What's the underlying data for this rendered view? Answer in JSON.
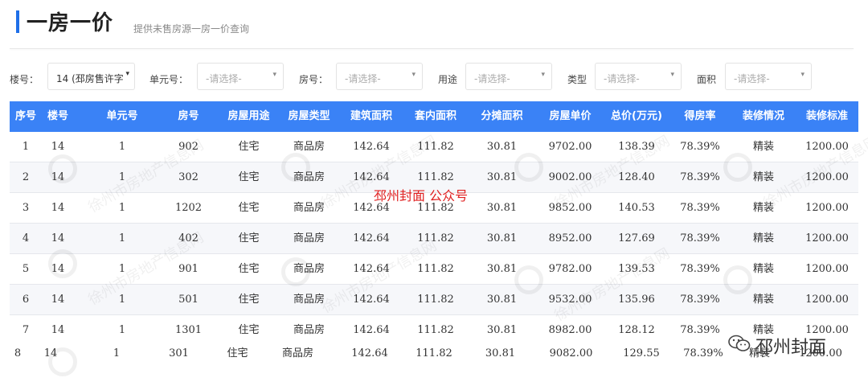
{
  "header": {
    "title": "一房一价",
    "subtitle": "提供未售房源一房一价查询"
  },
  "filters": {
    "building_label": "楼号：",
    "building_value": "14 (邳房售许字",
    "unit_label": "单元号：",
    "unit_placeholder": "-请选择-",
    "room_label": "房号：",
    "room_placeholder": "-请选择-",
    "usage_label": "用途",
    "usage_placeholder": "-请选择-",
    "type_label": "类型",
    "type_placeholder": "-请选择-",
    "area_label": "面积",
    "area_placeholder": "-请选择-"
  },
  "table": {
    "headers": [
      "序号",
      "楼号",
      "单元号",
      "房号",
      "房屋用途",
      "房屋类型",
      "建筑面积",
      "套内面积",
      "分摊面积",
      "房屋单价",
      "总价(万元)",
      "得房率",
      "装修情况",
      "装修标准"
    ],
    "rows": [
      [
        "1",
        "14",
        "1",
        "902",
        "住宅",
        "商品房",
        "142.64",
        "111.82",
        "30.81",
        "9702.00",
        "138.39",
        "78.39%",
        "精装",
        "1200.00"
      ],
      [
        "2",
        "14",
        "1",
        "302",
        "住宅",
        "商品房",
        "142.64",
        "111.82",
        "30.81",
        "9002.00",
        "128.40",
        "78.39%",
        "精装",
        "1200.00"
      ],
      [
        "3",
        "14",
        "1",
        "1202",
        "住宅",
        "商品房",
        "142.64",
        "111.82",
        "30.81",
        "9852.00",
        "140.53",
        "78.39%",
        "精装",
        "1200.00"
      ],
      [
        "4",
        "14",
        "1",
        "402",
        "住宅",
        "商品房",
        "142.64",
        "111.82",
        "30.81",
        "8952.00",
        "127.69",
        "78.39%",
        "精装",
        "1200.00"
      ],
      [
        "5",
        "14",
        "1",
        "901",
        "住宅",
        "商品房",
        "142.64",
        "111.82",
        "30.81",
        "9782.00",
        "139.53",
        "78.39%",
        "精装",
        "1200.00"
      ],
      [
        "6",
        "14",
        "1",
        "501",
        "住宅",
        "商品房",
        "142.64",
        "111.82",
        "30.81",
        "9532.00",
        "135.96",
        "78.39%",
        "精装",
        "1200.00"
      ],
      [
        "7",
        "14",
        "1",
        "1301",
        "住宅",
        "商品房",
        "142.64",
        "111.82",
        "30.81",
        "8982.00",
        "128.12",
        "78.39%",
        "精装",
        "1200.00"
      ]
    ],
    "last_row": [
      "8",
      "14",
      "1",
      "301",
      "住宅",
      "商品房",
      "142.64",
      "111.82",
      "30.81",
      "9082.00",
      "129.55",
      "78.39%",
      "精装",
      "1200.00"
    ]
  },
  "watermark_text": "徐州市房地产信息网",
  "overlay_caption": "邳州封面 公众号",
  "brand": {
    "name": "邳州封面",
    "icon": "wechat-icon"
  },
  "colors": {
    "accent": "#1f6fe8",
    "table_header": "#3a82f6",
    "overlay_red": "#e02020"
  }
}
